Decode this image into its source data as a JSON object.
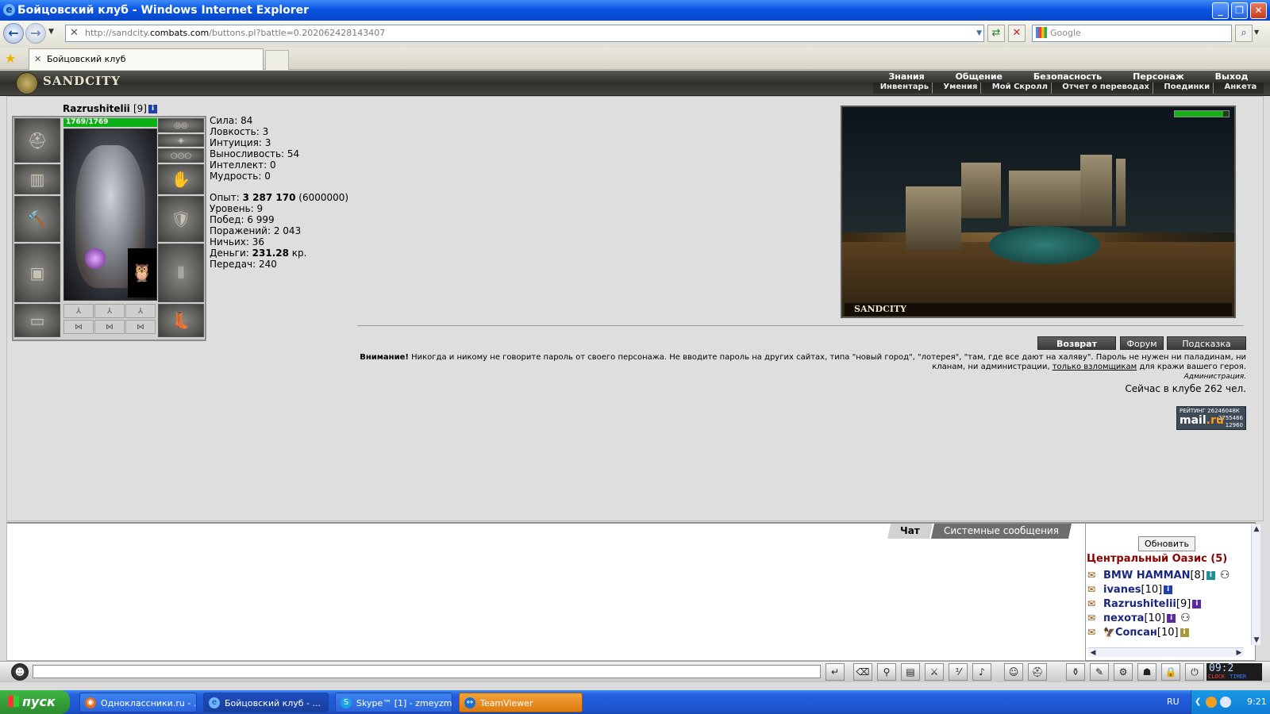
{
  "window": {
    "title": "Бойцовский клуб - Windows Internet Explorer",
    "url_prefix": "http://sandcity.",
    "url_host": "combats.com",
    "url_path": "/buttons.pl?battle=0.202062428143407",
    "search_placeholder": "Google",
    "tab_title": "Бойцовский клуб"
  },
  "game": {
    "logo": "SANDCITY",
    "top_menu": [
      "Знания",
      "Общение",
      "Безопасность",
      "Персонаж",
      "Выход"
    ],
    "sub_menu": [
      "Инвентарь",
      "Умения",
      "Мой Скролл",
      "Отчет о переводах",
      "Поединки",
      "Анкета"
    ]
  },
  "character": {
    "name": "Razrushitelii",
    "level": "[9]",
    "info_icon": "i",
    "hp": "1769/1769",
    "stats": [
      {
        "label": "Сила:",
        "value": "84"
      },
      {
        "label": "Ловкость:",
        "value": "3"
      },
      {
        "label": "Интуиция:",
        "value": "3"
      },
      {
        "label": "Выносливость:",
        "value": "54"
      },
      {
        "label": "Интеллект:",
        "value": "0"
      },
      {
        "label": "Мудрость:",
        "value": "0"
      }
    ],
    "exp_label": "Опыт:",
    "exp_value": "3 287 170",
    "exp_next": "(6000000)",
    "level_label": "Уровень:",
    "level_value": "9",
    "wins_label": "Побед:",
    "wins_value": "6 999",
    "losses_label": "Поражений:",
    "losses_value": "2 043",
    "draws_label": "Ничьих:",
    "draws_value": "36",
    "money_label": "Деньги:",
    "money_value": "231.28",
    "money_unit": "кр.",
    "transfers_label": "Передач:",
    "transfers_value": "240"
  },
  "location": {
    "name": "SANDCITY",
    "buttons": {
      "return": "Возврат",
      "forum": "Форум",
      "hint": "Подсказка"
    },
    "warning_bold": "Внимание!",
    "warning_text_1": "Никогда и никому не говорите пароль от своего персонажа. Не вводите пароль на других сайтах, типа \"новый город\", \"лотерея\", \"там, где все дают на халяву\". Пароль не нужен ни паладинам, ни кланам, ни администрации,",
    "warning_link": "только взломщикам",
    "warning_text_2": "для кражи вашего героя.",
    "signature": "Администрация.",
    "online_text": "Сейчас в клубе 262 чел.",
    "rating_label": "РЕЙТИНГ",
    "rating_values": [
      "26246048К",
      "2755466",
      "12960"
    ],
    "rating_brand_1": "mail",
    "rating_brand_2": ".ru"
  },
  "chat": {
    "tabs": [
      {
        "label": "Чат",
        "active": true
      },
      {
        "label": "Системные сообщения",
        "active": false
      }
    ],
    "refresh_label": "Обновить",
    "location_title": "Центральный Оазис (5)",
    "users": [
      {
        "name": "BMW HAMMAN",
        "level": "[8]",
        "extra": true
      },
      {
        "name": "ivanes",
        "level": "[10]",
        "extra": false
      },
      {
        "name": "Razrushitelii",
        "level": "[9]",
        "extra": false
      },
      {
        "name": "пехота",
        "level": "[10]",
        "extra": true
      },
      {
        "name": "Сопсан",
        "level": "[10]",
        "extra": false
      }
    ],
    "clock_time": "09:2",
    "clock_sub_1": "CLOCK",
    "clock_sub_2": "TIMER"
  },
  "taskbar": {
    "start_label": "пуск",
    "tasks": [
      {
        "label": "Одноклассники.ru - ...",
        "active": false
      },
      {
        "label": "Бойцовский клуб - ...",
        "active": true
      },
      {
        "label": "Skype™ [1] - zmeyzm...",
        "active": false
      },
      {
        "label": "TeamViewer",
        "active": false
      }
    ],
    "lang": "RU",
    "time": "9:21"
  },
  "colors": {
    "hp_green": "#0ab016",
    "user_blue": "#1a2680",
    "location_title_red": "#8b0000"
  }
}
